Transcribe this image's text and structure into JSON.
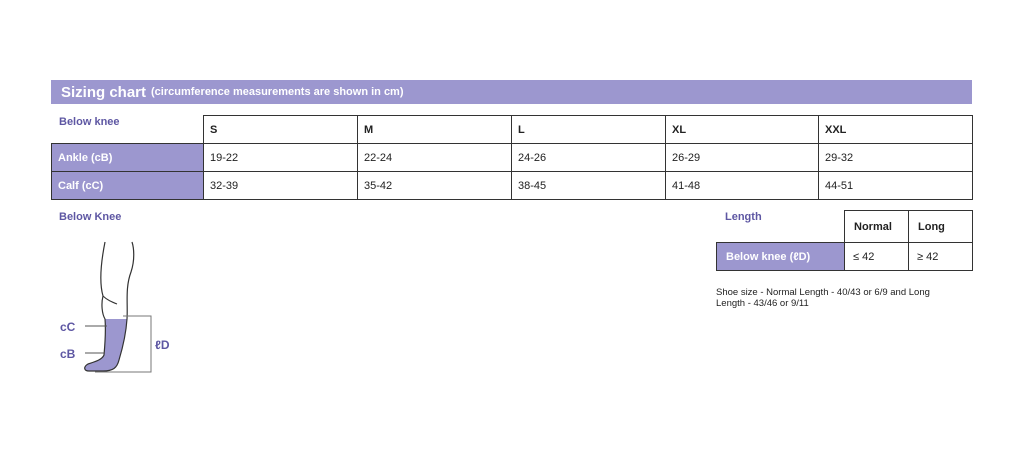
{
  "header": {
    "title": "Sizing chart",
    "note": "(circumference measurements are shown in cm)",
    "bg_color": "#9c97cf"
  },
  "size_table": {
    "corner_label": "Below knee",
    "columns": [
      "S",
      "M",
      "L",
      "XL",
      "XXL"
    ],
    "rows": [
      {
        "label": "Ankle (cB)",
        "values": [
          "19-22",
          "22-24",
          "24-26",
          "26-29",
          "29-32"
        ]
      },
      {
        "label": "Calf (cC)",
        "values": [
          "32-39",
          "35-42",
          "38-45",
          "41-48",
          "44-51"
        ]
      }
    ]
  },
  "diagram": {
    "title": "Below Knee",
    "labels": {
      "calf": "cC",
      "ankle": "cB",
      "length": "ℓD"
    },
    "fill_color": "#9c97cf"
  },
  "length_table": {
    "title": "Length",
    "columns": [
      "Normal",
      "Long"
    ],
    "rows": [
      {
        "label": "Below knee (ℓD)",
        "values": [
          "≤ 42",
          "≥ 42"
        ]
      }
    ]
  },
  "shoe_note": "Shoe size - Normal Length - 40/43 or 6/9 and Long Length - 43/46 or 9/11",
  "accent_text_color": "#5e57a3"
}
